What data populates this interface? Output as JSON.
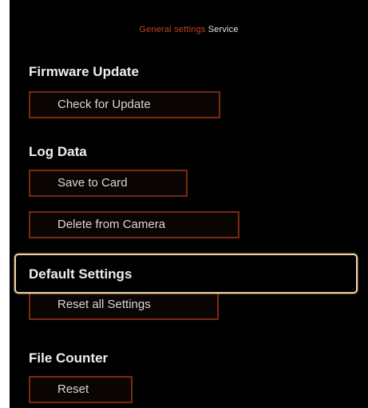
{
  "breadcrumb": {
    "path": "General settings",
    "current": "Service"
  },
  "sections": {
    "firmware": {
      "title": "Firmware Update",
      "check_button": "Check for Update"
    },
    "log": {
      "title": "Log Data",
      "save_button": "Save to Card",
      "delete_button": "Delete from Camera"
    },
    "defaults": {
      "title": "Default Settings",
      "reset_button": "Reset all Settings"
    },
    "file_counter": {
      "title": "File Counter",
      "reset_button": "Reset"
    }
  },
  "colors": {
    "background": "#000000",
    "accent": "#c2411c",
    "button_border": "#7a2a12",
    "focus_border": "#f1d2ad",
    "text": "#eeeeee"
  }
}
